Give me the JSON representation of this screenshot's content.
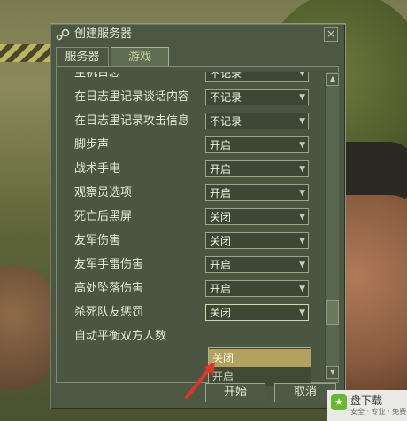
{
  "window": {
    "title": "创建服务器",
    "close_label": "×"
  },
  "tabs": [
    {
      "label": "服务器"
    },
    {
      "label": "游戏"
    }
  ],
  "settings": [
    {
      "label": "主机日志",
      "value": "不记录"
    },
    {
      "label": "在日志里记录谈话内容",
      "value": "不记录"
    },
    {
      "label": "在日志里记录攻击信息",
      "value": "不记录"
    },
    {
      "label": "脚步声",
      "value": "开启"
    },
    {
      "label": "战术手电",
      "value": "开启"
    },
    {
      "label": "观察员选项",
      "value": "开启"
    },
    {
      "label": "死亡后黑屏",
      "value": "关闭"
    },
    {
      "label": "友军伤害",
      "value": "关闭"
    },
    {
      "label": "友军手雷伤害",
      "value": "开启"
    },
    {
      "label": "高处坠落伤害",
      "value": "开启"
    },
    {
      "label": "杀死队友惩罚",
      "value": "关闭"
    },
    {
      "label": "自动平衡双方人数",
      "value": ""
    }
  ],
  "dropdown_menu": {
    "options": [
      "关闭",
      "开启"
    ]
  },
  "buttons": {
    "start": "开始",
    "cancel": "取消"
  },
  "scrollbar": {
    "position": 0.75
  },
  "watermark": {
    "text": "盘下载",
    "sub": "安全 · 专业 · 免费"
  },
  "colors": {
    "window_bg": "#4c5844",
    "highlight": "#b3a25f",
    "text": "#e6e8d8",
    "arrow": "#e0352b"
  }
}
